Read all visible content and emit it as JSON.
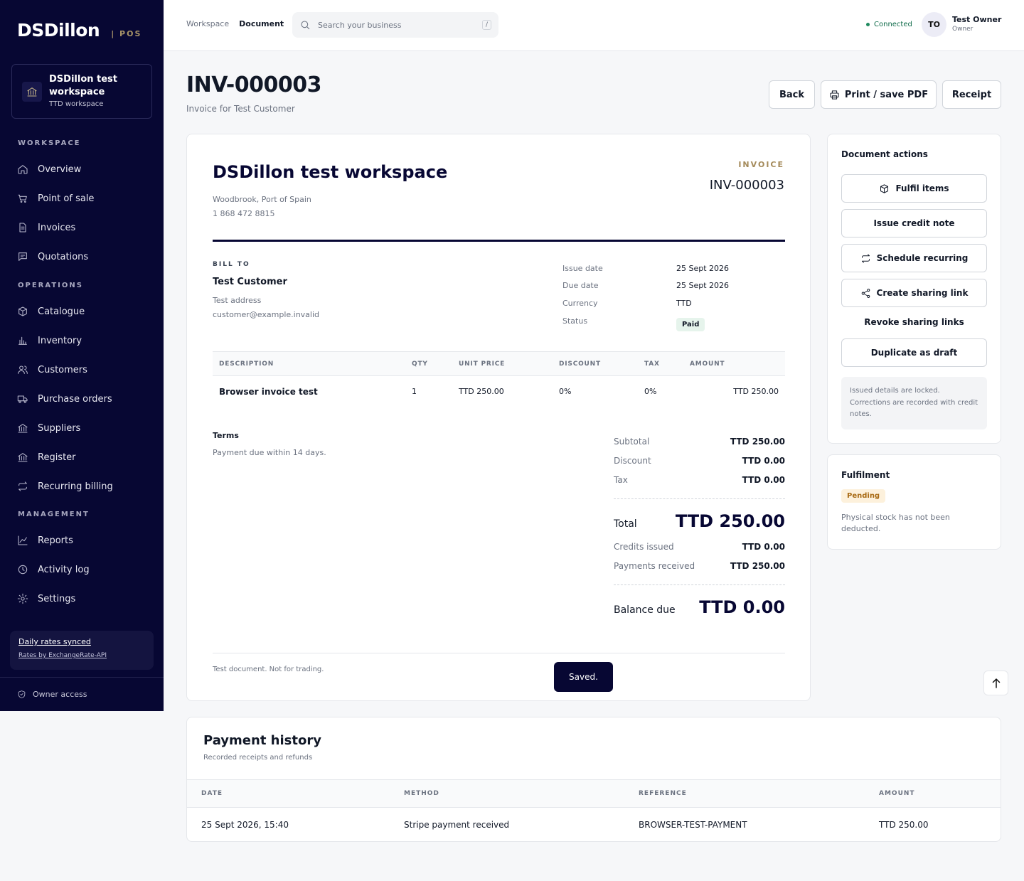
{
  "brand": {
    "name": "DSDillon",
    "tag": "| POS"
  },
  "workspace_card": {
    "title": "DSDillon test workspace",
    "subtitle": "TTD workspace"
  },
  "sidebar": {
    "sections": {
      "workspace": "WORKSPACE",
      "operations": "OPERATIONS",
      "management": "MANAGEMENT"
    },
    "items": [
      {
        "label": "Overview",
        "icon": "home-icon"
      },
      {
        "label": "Point of sale",
        "icon": "cart-icon"
      },
      {
        "label": "Invoices",
        "icon": "document-icon"
      },
      {
        "label": "Quotations",
        "icon": "message-icon"
      },
      {
        "label": "Catalogue",
        "icon": "box-icon"
      },
      {
        "label": "Inventory",
        "icon": "bar-chart-icon"
      },
      {
        "label": "Customers",
        "icon": "users-icon"
      },
      {
        "label": "Purchase orders",
        "icon": "truck-icon"
      },
      {
        "label": "Suppliers",
        "icon": "bank-icon"
      },
      {
        "label": "Register",
        "icon": "bank-icon"
      },
      {
        "label": "Recurring billing",
        "icon": "repeat-icon"
      },
      {
        "label": "Reports",
        "icon": "line-chart-icon"
      },
      {
        "label": "Activity log",
        "icon": "clock-icon"
      },
      {
        "label": "Settings",
        "icon": "gear-icon"
      }
    ],
    "rates": {
      "synced": "Daily rates synced",
      "source": "Rates by ExchangeRate-API"
    },
    "access": "Owner access"
  },
  "topbar": {
    "crumb_workspace": "Workspace",
    "crumb_document": "Document",
    "search_placeholder": "Search your business",
    "search_kbd": "/",
    "status": "Connected",
    "user": {
      "initials": "TO",
      "name": "Test Owner",
      "role": "Owner"
    }
  },
  "header": {
    "title": "INV-000003",
    "subtitle": "Invoice for Test Customer",
    "back": "Back",
    "print": "Print / save PDF",
    "receipt": "Receipt"
  },
  "invoice": {
    "business": "DSDillon test workspace",
    "address": "Woodbrook, Port of Spain",
    "phone": "1 868 472 8815",
    "label": "INVOICE",
    "number": "INV-000003",
    "bill_to_label": "BILL TO",
    "customer": "Test Customer",
    "customer_address": "Test address",
    "customer_email": "customer@example.invalid",
    "meta": {
      "issue_label": "Issue date",
      "issue": "25 Sept 2026",
      "due_label": "Due date",
      "due": "25 Sept 2026",
      "currency_label": "Currency",
      "currency": "TTD",
      "status_label": "Status",
      "status": "Paid"
    },
    "columns": [
      "DESCRIPTION",
      "QTY",
      "UNIT PRICE",
      "DISCOUNT",
      "TAX",
      "AMOUNT"
    ],
    "items": [
      {
        "description": "Browser invoice test",
        "qty": "1",
        "unit_price": "TTD 250.00",
        "discount": "0%",
        "tax": "0%",
        "amount": "TTD 250.00"
      }
    ],
    "terms_label": "Terms",
    "terms": "Payment due within 14 days.",
    "totals": {
      "subtotal_label": "Subtotal",
      "subtotal": "TTD 250.00",
      "discount_label": "Discount",
      "discount": "TTD 0.00",
      "tax_label": "Tax",
      "tax": "TTD 0.00",
      "total_label": "Total",
      "total": "TTD 250.00",
      "credits_label": "Credits issued",
      "credits": "TTD 0.00",
      "payments_label": "Payments received",
      "payments": "TTD 250.00",
      "balance_label": "Balance due",
      "balance": "TTD 0.00"
    },
    "footnote": "Test document. Not for trading.",
    "toast": "Saved."
  },
  "actions": {
    "title": "Document actions",
    "fulfil": "Fulfil items",
    "credit": "Issue credit note",
    "recurring": "Schedule recurring",
    "share": "Create sharing link",
    "revoke": "Revoke sharing links",
    "duplicate": "Duplicate as draft",
    "note": "Issued details are locked. Corrections are recorded with credit notes."
  },
  "fulfilment": {
    "title": "Fulfilment",
    "status": "Pending",
    "note": "Physical stock has not been deducted."
  },
  "payments": {
    "title": "Payment history",
    "subtitle": "Recorded receipts and refunds",
    "columns": [
      "DATE",
      "METHOD",
      "REFERENCE",
      "AMOUNT"
    ],
    "rows": [
      {
        "date": "25 Sept 2026, 15:40",
        "method": "Stripe payment received",
        "reference": "BROWSER-TEST-PAYMENT",
        "amount": "TTD 250.00"
      }
    ]
  },
  "colors": {
    "navy": "#070733",
    "gold": "#a48a5a",
    "paid": "#137a4b",
    "pending": "#a86a14"
  }
}
